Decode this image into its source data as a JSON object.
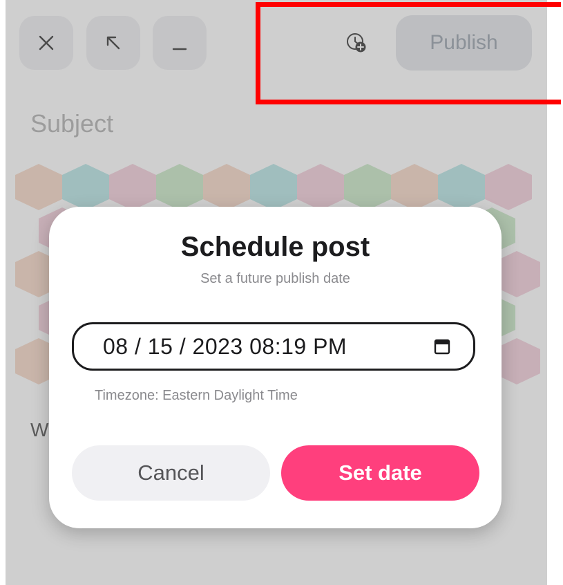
{
  "toolbar": {
    "close_icon": "close-icon",
    "expand_icon": "arrow-up-left-icon",
    "minimize_icon": "minimize-icon",
    "schedule_icon": "clock-plus-icon",
    "publish_label": "Publish"
  },
  "editor": {
    "subject_placeholder": "Subject",
    "partial_text": "W"
  },
  "dialog": {
    "title": "Schedule post",
    "subtitle": "Set a future publish date",
    "datetime_value": "08 / 15 / 2023  08:19  PM",
    "calendar_icon": "calendar-icon",
    "timezone": "Timezone: Eastern Daylight Time",
    "cancel_label": "Cancel",
    "set_label": "Set date"
  },
  "colors": {
    "accent": "#ff3f7d",
    "overlay": "rgba(110,110,110,0.33)",
    "annotation": "#ff0000",
    "hex_tiles": [
      "#f6d9c8",
      "#b9e6e6",
      "#f3cfdc",
      "#cbe9c8"
    ]
  }
}
